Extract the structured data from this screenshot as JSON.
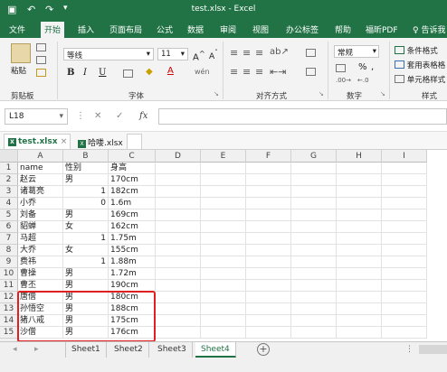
{
  "window": {
    "title": "test.xlsx  -  Excel"
  },
  "ribbon_tabs": [
    "文件",
    "开始",
    "插入",
    "页面布局",
    "公式",
    "数据",
    "审阅",
    "视图",
    "办公标签",
    "帮助",
    "福昕PDF",
    "告诉我"
  ],
  "active_tab": "开始",
  "ribbon": {
    "paste": "粘贴",
    "clipboard": "剪贴板",
    "font_name": "等线",
    "font_size": "11",
    "font_group": "字体",
    "align_group": "对齐方式",
    "number_format": "常规",
    "number_group": "数字",
    "cond_format": "条件格式",
    "table_format": "套用表格格",
    "cell_style": "单元格样式",
    "styles_group": "样式",
    "bold": "B",
    "italic": "I",
    "underline": "U",
    "percent": "%",
    "comma": ","
  },
  "formula_bar": {
    "name_box": "L18",
    "fx": "fx",
    "cancel": "✕",
    "enter": "✓",
    "value": ""
  },
  "file_tabs": [
    {
      "label": "test.xlsx",
      "active": true
    },
    {
      "label": "哈喽.xlsx",
      "active": false
    }
  ],
  "columns": [
    "A",
    "B",
    "C",
    "D",
    "E",
    "F",
    "G",
    "H",
    "I"
  ],
  "rows": [
    {
      "n": "1",
      "a": "name",
      "b": "性别",
      "b_num": false,
      "c": "身高"
    },
    {
      "n": "2",
      "a": "赵云",
      "b": "男",
      "b_num": false,
      "c": "170cm"
    },
    {
      "n": "3",
      "a": "诸葛亮",
      "b": "1",
      "b_num": true,
      "c": "182cm"
    },
    {
      "n": "4",
      "a": "小乔",
      "b": "0",
      "b_num": true,
      "c": "1.6m"
    },
    {
      "n": "5",
      "a": "刘备",
      "b": "男",
      "b_num": false,
      "c": "169cm"
    },
    {
      "n": "6",
      "a": "貂蝉",
      "b": "女",
      "b_num": false,
      "c": "162cm"
    },
    {
      "n": "7",
      "a": "马超",
      "b": "1",
      "b_num": true,
      "c": "1.75m"
    },
    {
      "n": "8",
      "a": "大乔",
      "b": "女",
      "b_num": false,
      "c": "155cm"
    },
    {
      "n": "9",
      "a": "费祎",
      "b": "1",
      "b_num": true,
      "c": "1.88m"
    },
    {
      "n": "10",
      "a": "曹操",
      "b": "男",
      "b_num": false,
      "c": "1.72m"
    },
    {
      "n": "11",
      "a": "曹丕",
      "b": "男",
      "b_num": false,
      "c": "190cm"
    },
    {
      "n": "12",
      "a": "唐僧",
      "b": "男",
      "b_num": false,
      "c": "180cm"
    },
    {
      "n": "13",
      "a": "孙悟空",
      "b": "男",
      "b_num": false,
      "c": "188cm"
    },
    {
      "n": "14",
      "a": "猪八戒",
      "b": "男",
      "b_num": false,
      "c": "175cm"
    },
    {
      "n": "15",
      "a": "沙僧",
      "b": "男",
      "b_num": false,
      "c": "176cm"
    }
  ],
  "sheets": [
    "Sheet1",
    "Sheet2",
    "Sheet3",
    "Sheet4"
  ],
  "active_sheet": "Sheet4",
  "add_sheet": "+",
  "colors": {
    "excel_green": "#217346",
    "highlight": "#e02020"
  }
}
